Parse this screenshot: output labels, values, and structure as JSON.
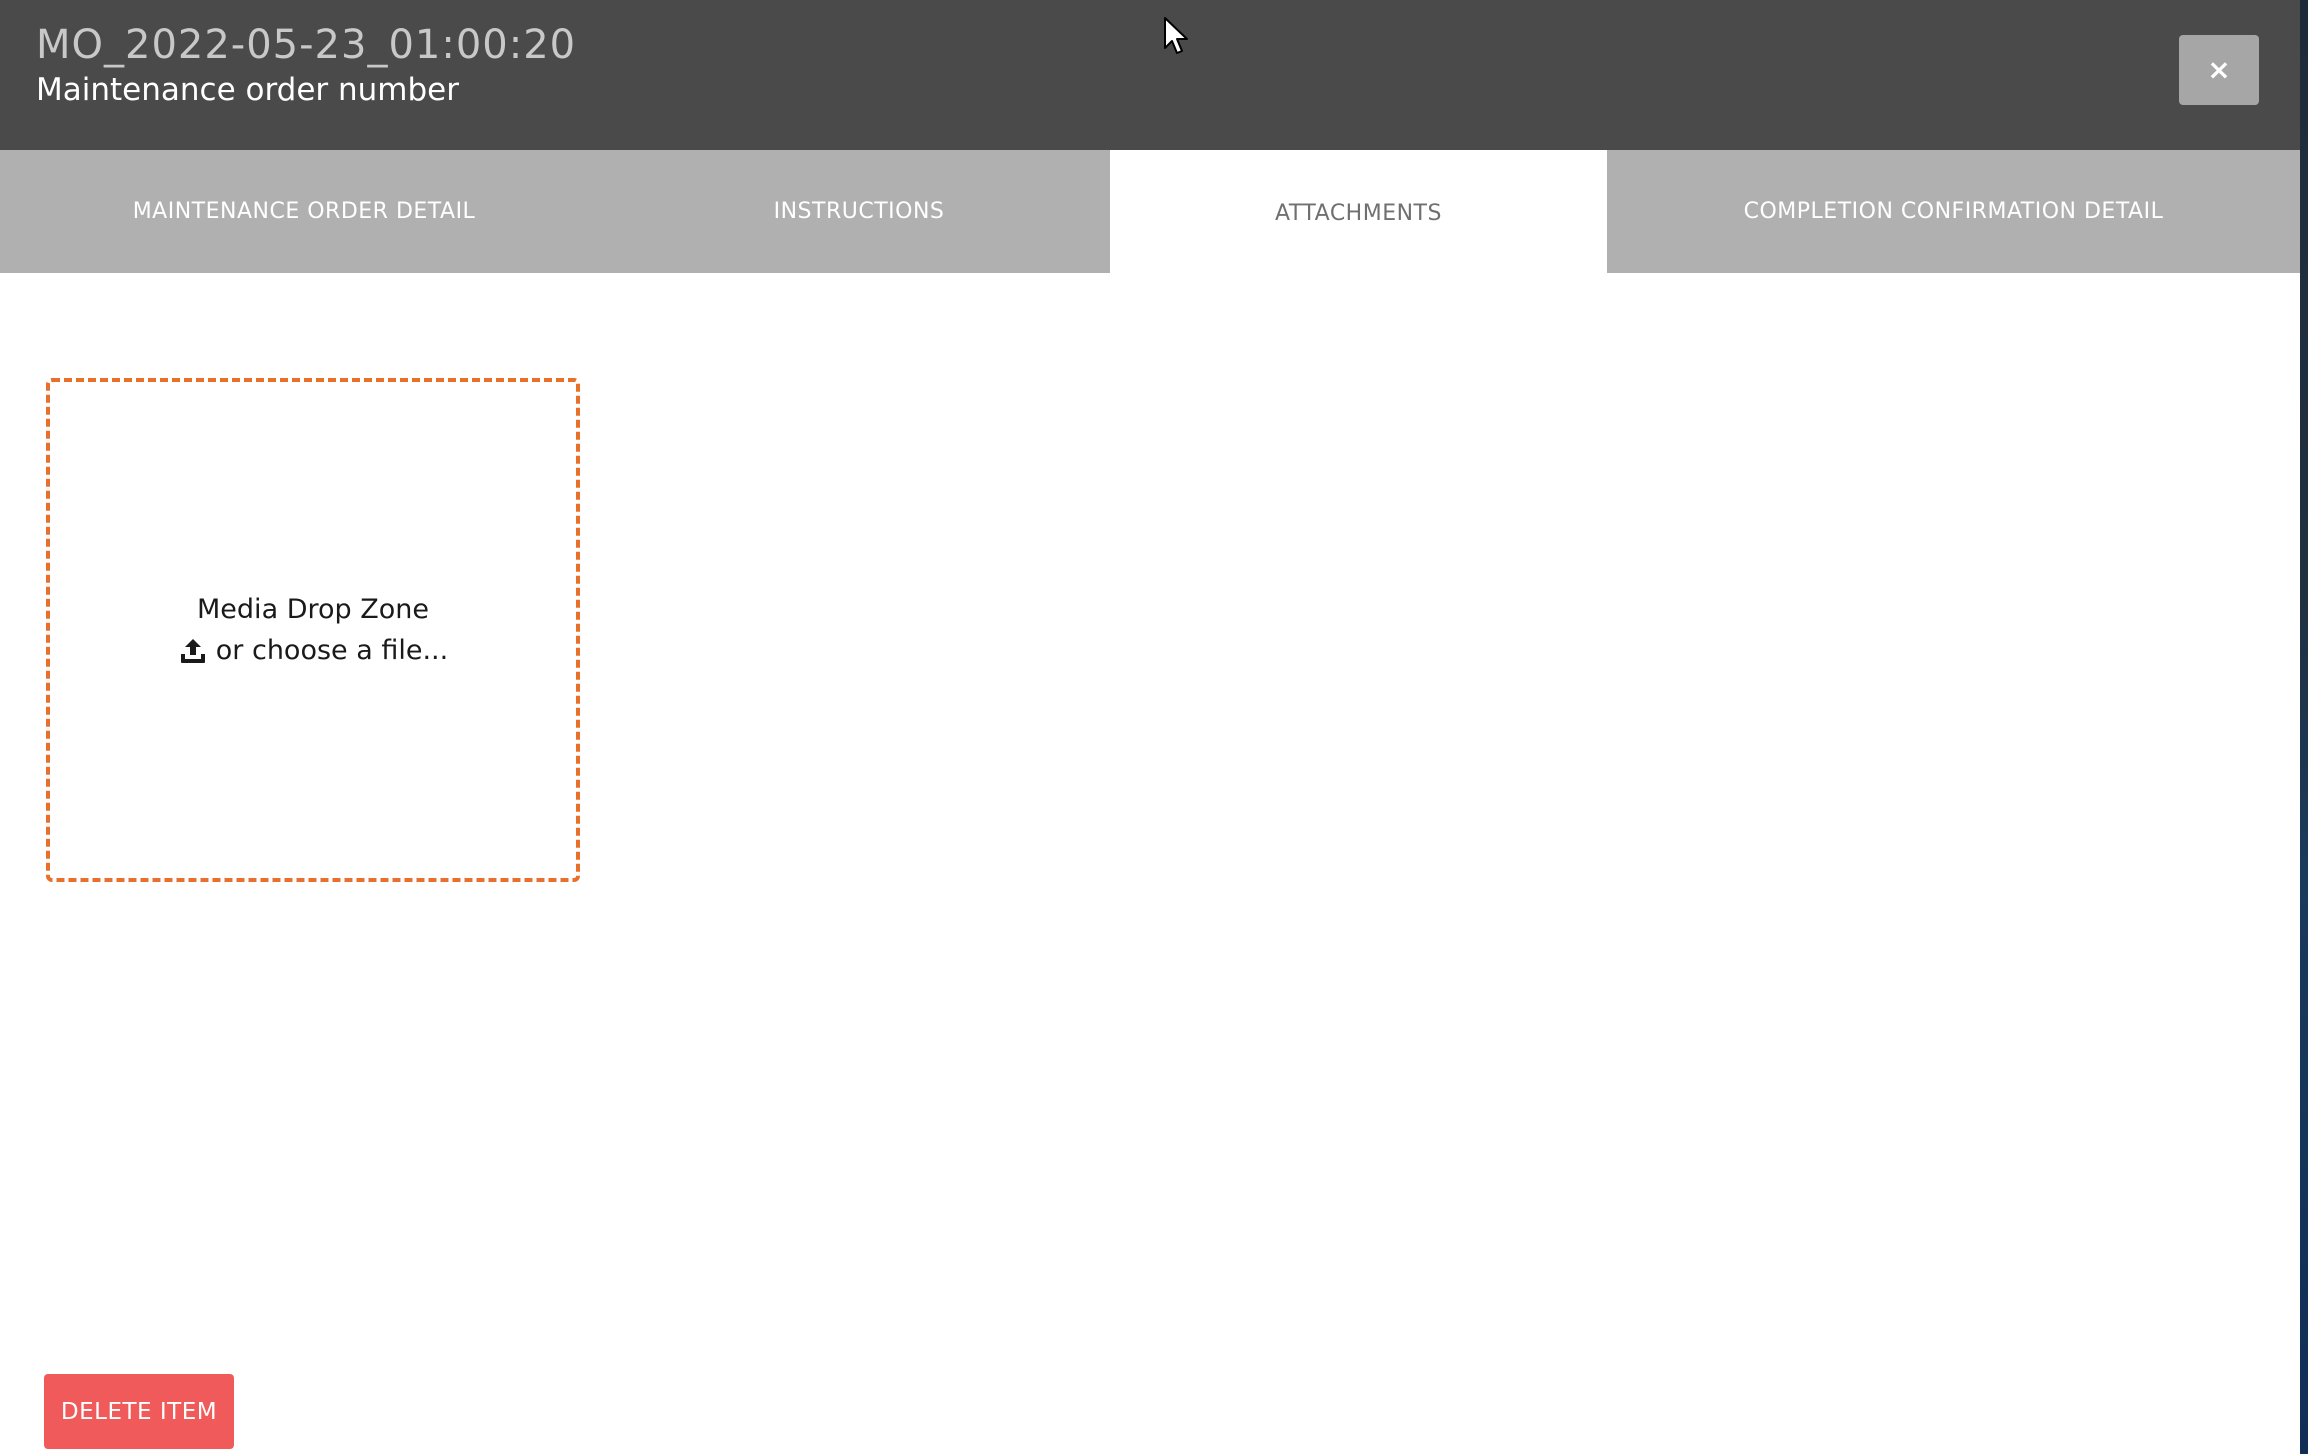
{
  "header": {
    "order_id": "MO_2022-05-23_01:00:20",
    "order_label": "Maintenance order number",
    "close_label": "×"
  },
  "tabs": [
    {
      "label": "MAINTENANCE ORDER DETAIL",
      "active": false
    },
    {
      "label": "INSTRUCTIONS",
      "active": false
    },
    {
      "label": "ATTACHMENTS",
      "active": true
    },
    {
      "label": "COMPLETION CONFIRMATION DETAIL",
      "active": false
    }
  ],
  "dropzone": {
    "title": "Media Drop Zone",
    "choose_label": "or choose a file...",
    "icon": "upload-icon",
    "border_color": "#e8702a"
  },
  "actions": {
    "delete_label": "DELETE ITEM",
    "delete_color": "#f05a5a"
  },
  "colors": {
    "header_bg": "#4a4a4a",
    "tab_bg": "#b0b0b0",
    "tab_active_bg": "#ffffff"
  }
}
